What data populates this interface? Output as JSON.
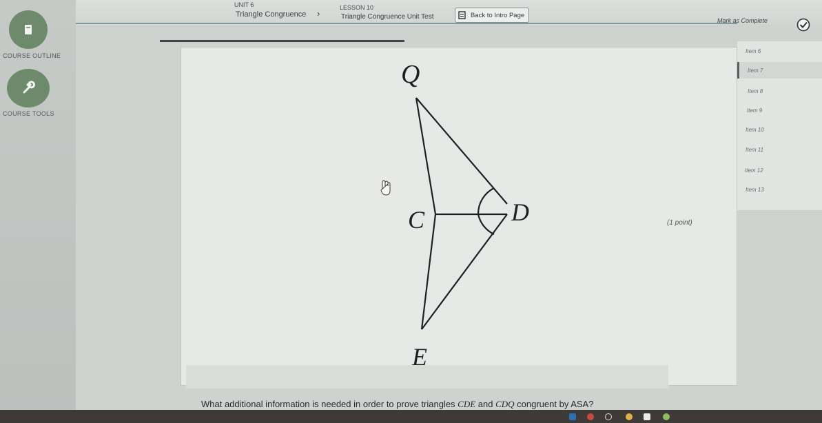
{
  "header": {
    "unit_label": "UNIT 6",
    "unit_title": "Triangle Congruence",
    "lesson_label": "LESSON 10",
    "lesson_title": "Triangle Congruence Unit Test",
    "back_button": "Back to Intro Page",
    "mark_complete": "Mark as Complete"
  },
  "sidebar": {
    "course_outline": "COURSE OUTLINE",
    "course_tools": "COURSE TOOLS"
  },
  "items": [
    {
      "label": "Item 6"
    },
    {
      "label": "Item 7",
      "active": true
    },
    {
      "label": "Item 8"
    },
    {
      "label": "Item 9"
    },
    {
      "label": "Item 10"
    },
    {
      "label": "Item 11"
    },
    {
      "label": "Item 12"
    },
    {
      "label": "Item 13"
    }
  ],
  "question": {
    "points": "(1 point)",
    "prompt_before": "What additional information is needed in order to prove triangles ",
    "tri1": "CDE",
    "prompt_mid": " and ",
    "tri2": "CDQ",
    "prompt_after": " congruent by ASA?"
  },
  "diagram": {
    "label_q": "Q",
    "label_c": "C",
    "label_d": "D",
    "label_e": "E"
  },
  "colors": {
    "rail_button": "#6e8a6d",
    "check_green": "#3a8a3a",
    "taskbar": "#3e3a37"
  }
}
